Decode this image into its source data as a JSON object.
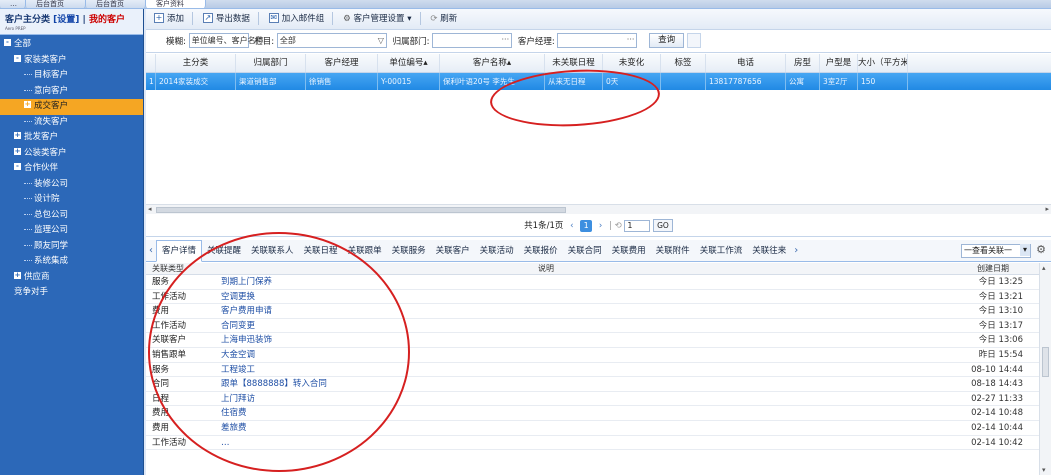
{
  "top_tabs": [
    "…",
    "后台首页",
    "后台首页",
    "客户资料"
  ],
  "sidebar": {
    "title_prefix": "客户主分类",
    "title_settings": "[设置]",
    "title_sep": "|",
    "title_mine": "我的客户",
    "subtitle": "Aero PREP",
    "items": [
      {
        "label": "全部",
        "level": 0,
        "toggle": "-"
      },
      {
        "label": "家装类客户",
        "level": 1,
        "toggle": "-"
      },
      {
        "label": "目标客户",
        "level": 2,
        "toggle": ""
      },
      {
        "label": "意向客户",
        "level": 2,
        "toggle": ""
      },
      {
        "label": "成交客户",
        "level": 2,
        "toggle": "+"
      },
      {
        "label": "流失客户",
        "level": 2,
        "toggle": ""
      },
      {
        "label": "批发客户",
        "level": 1,
        "toggle": "+"
      },
      {
        "label": "公装类客户",
        "level": 1,
        "toggle": "+"
      },
      {
        "label": "合作伙伴",
        "level": 1,
        "toggle": "-"
      },
      {
        "label": "装修公司",
        "level": 2,
        "toggle": ""
      },
      {
        "label": "设计院",
        "level": 2,
        "toggle": ""
      },
      {
        "label": "总包公司",
        "level": 2,
        "toggle": ""
      },
      {
        "label": "监理公司",
        "level": 2,
        "toggle": ""
      },
      {
        "label": "顾友同学",
        "level": 2,
        "toggle": ""
      },
      {
        "label": "系统集成",
        "level": 2,
        "toggle": ""
      },
      {
        "label": "供应商",
        "level": 1,
        "toggle": "+"
      },
      {
        "label": "竞争对手",
        "level": 1,
        "toggle": ""
      }
    ]
  },
  "toolbar": {
    "add": "添加",
    "export": "导出数据",
    "mail_group": "加入邮件组",
    "settings": "客户管理设置",
    "settings_caret": "▾",
    "refresh": "刷新"
  },
  "filter": {
    "fuzzy_label": "模糊:",
    "fuzzy_value": "单位编号、客户名称",
    "column_label": "栏目:",
    "column_value": "全部",
    "dept_label": "归属部门:",
    "dept_value": "",
    "manager_label": "客户经理:",
    "manager_value": "",
    "query_button": "查询"
  },
  "grid": {
    "columns": [
      "",
      "主分类",
      "归属部门",
      "客户经理",
      "单位编号▴",
      "客户名称▴",
      "未关联日程",
      "未变化",
      "标签",
      "电话",
      "房型",
      "户型是",
      "大小（平方米"
    ],
    "rows": [
      [
        "1",
        "2014家装成交",
        "渠道销售部",
        "徐销售",
        "Y-00015",
        "保利叶语20号 李先生",
        "从来无日程",
        "0天",
        "",
        "13817787656",
        "公寓",
        "3室2厅",
        "150"
      ]
    ]
  },
  "pager": {
    "summary": "共1条/1页",
    "current_page": "1",
    "page_input": "1",
    "go": "GO"
  },
  "tabs": {
    "items": [
      "客户详情",
      "关联提醒",
      "关联联系人",
      "关联日程",
      "关联跟单",
      "关联服务",
      "关联客户",
      "关联活动",
      "关联报价",
      "关联合同",
      "关联费用",
      "关联附件",
      "关联工作流",
      "关联往来"
    ],
    "view_select": "一查看关联一"
  },
  "detail": {
    "headers": {
      "type": "关联类型",
      "desc": "说明",
      "date": "创建日期"
    },
    "rows": [
      {
        "type": "服务",
        "desc": "到期上门保养",
        "date": "今日 13:25"
      },
      {
        "type": "工作活动",
        "desc": "空调更换",
        "date": "今日 13:21"
      },
      {
        "type": "费用",
        "desc": "客户费用申请",
        "date": "今日 13:10"
      },
      {
        "type": "工作活动",
        "desc": "合同变更",
        "date": "今日 13:17"
      },
      {
        "type": "关联客户",
        "desc": "上海申迅装饰",
        "date": "今日 13:06"
      },
      {
        "type": "销售跟单",
        "desc": "大金空调",
        "date": "昨日 15:54"
      },
      {
        "type": "服务",
        "desc": "工程竣工",
        "date": "08-10 14:44"
      },
      {
        "type": "合同",
        "desc": "跟单【8888888】转入合同",
        "date": "08-18 14:43"
      },
      {
        "type": "日程",
        "desc": "上门拜访",
        "date": "02-27 11:33"
      },
      {
        "type": "费用",
        "desc": "住宿费",
        "date": "02-14 10:48"
      },
      {
        "type": "费用",
        "desc": "差旅费",
        "date": "02-14 10:44"
      },
      {
        "type": "工作活动",
        "desc": "…",
        "date": "02-14 10:42"
      }
    ]
  },
  "colors": {
    "sidebar_bg": "#2c68b8",
    "selected_item": "#f5a623",
    "selected_row": "#2189e4",
    "annotation": "#d62020"
  }
}
